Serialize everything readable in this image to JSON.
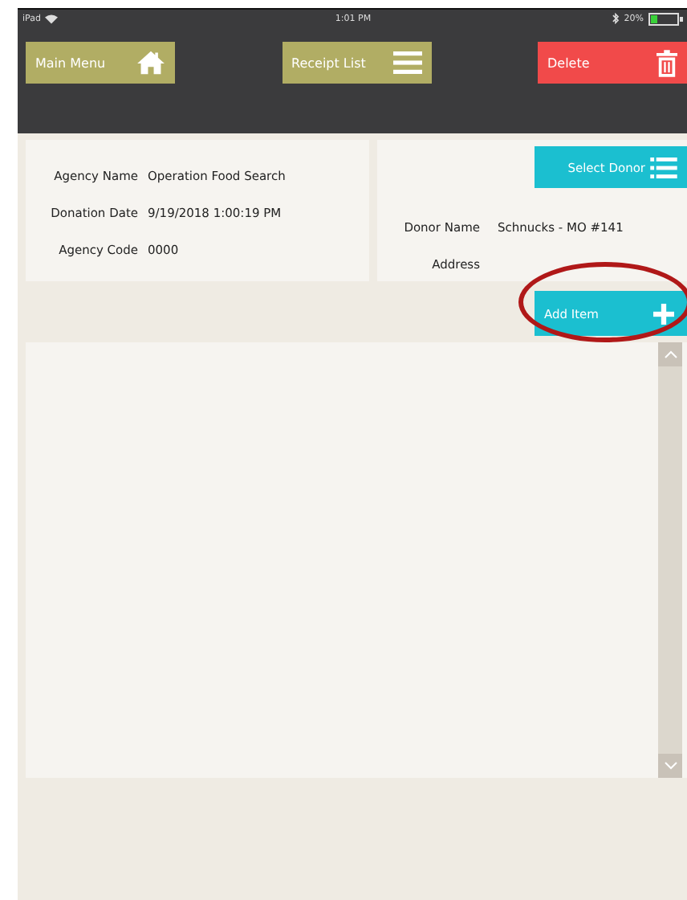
{
  "status_bar": {
    "device": "iPad",
    "time": "1:01 PM",
    "battery": "20%"
  },
  "toolbar": [
    {
      "label": "Main Menu",
      "kind": "home"
    },
    {
      "label": "Receipt List",
      "kind": "list"
    },
    {
      "label": "Delete",
      "kind": "delete"
    }
  ],
  "agency": [
    {
      "label": "Agency Name",
      "value": "Operation Food Search"
    },
    {
      "label": "Donation Date",
      "value": "9/19/2018 1:00:19 PM"
    },
    {
      "label": "Agency Code",
      "value": "0000"
    }
  ],
  "donor": {
    "button": "Select Donor",
    "fields": [
      {
        "label": "Donor Name",
        "value": "Schnucks - MO #141"
      },
      {
        "label": "Address"
      }
    ]
  },
  "add_item": {
    "label": "Add Item",
    "highlighted": true
  }
}
